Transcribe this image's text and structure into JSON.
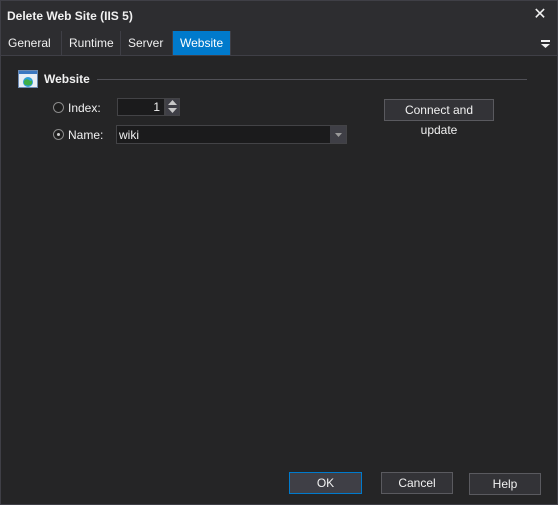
{
  "window": {
    "title": "Delete Web Site (IIS 5)"
  },
  "tabs": [
    {
      "label": "General"
    },
    {
      "label": "Runtime"
    },
    {
      "label": "Server"
    },
    {
      "label": "Website"
    }
  ],
  "active_tab": "Website",
  "section": {
    "title": "Website",
    "icon": "globe-window-icon"
  },
  "form": {
    "index_label": "Index:",
    "index_value": "1",
    "name_label": "Name:",
    "name_value": "wiki",
    "selected_option": "Name"
  },
  "connect_button": "Connect and update",
  "footer": {
    "ok": "OK",
    "cancel": "Cancel",
    "help": "Help"
  },
  "colors": {
    "accent": "#007acc",
    "background": "#252526",
    "titlebar": "#2d2d30"
  }
}
